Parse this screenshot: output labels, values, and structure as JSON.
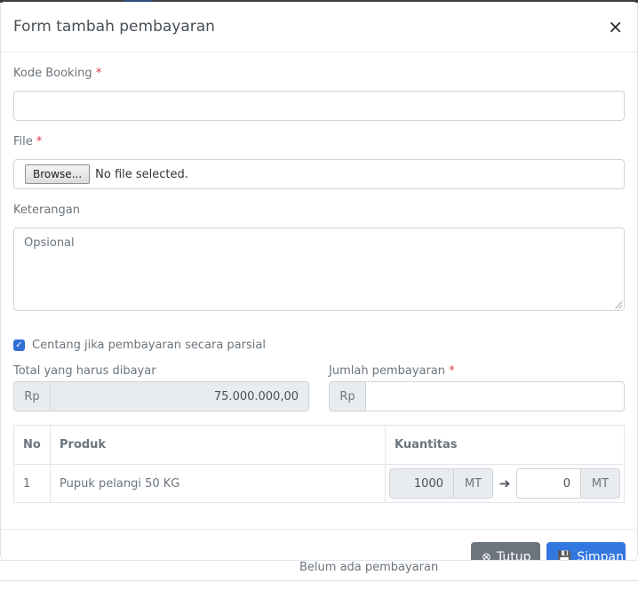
{
  "modal": {
    "title": "Form tambah pembayaran",
    "close_symbol": "×"
  },
  "form": {
    "kode_booking": {
      "label": "Kode Booking",
      "required_mark": "*",
      "value": ""
    },
    "file": {
      "label": "File",
      "required_mark": "*",
      "browse_label": "Browse...",
      "status": "No file selected."
    },
    "keterangan": {
      "label": "Keterangan",
      "placeholder": "Opsional",
      "value": ""
    },
    "partial_checkbox": {
      "label": "Centang jika pembayaran secara parsial",
      "checked": true
    },
    "total": {
      "label": "Total yang harus dibayar",
      "prefix": "Rp",
      "value": "75.000.000,00"
    },
    "jumlah": {
      "label": "Jumlah pembayaran",
      "required_mark": "*",
      "prefix": "Rp",
      "value": ""
    }
  },
  "table": {
    "headers": [
      "No",
      "Produk",
      "Kuantitas"
    ],
    "rows": [
      {
        "no": "1",
        "produk": "Pupuk pelangi 50 KG",
        "qty_available": "1000",
        "unit_available": "MT",
        "qty_input": "0",
        "unit_input": "MT"
      }
    ]
  },
  "footer": {
    "close_label": "Tutup",
    "save_label": "Simpan"
  },
  "background": {
    "empty_text": "Belum ada pembayaran"
  },
  "colors": {
    "primary": "#3377e0",
    "secondary": "#6c757d",
    "required": "#dc3545"
  },
  "icons": {
    "close": "close-icon",
    "checkbox": "check-icon",
    "arrow": "arrow-right-icon",
    "tutup": "times-circle-icon",
    "simpan": "save-icon"
  }
}
